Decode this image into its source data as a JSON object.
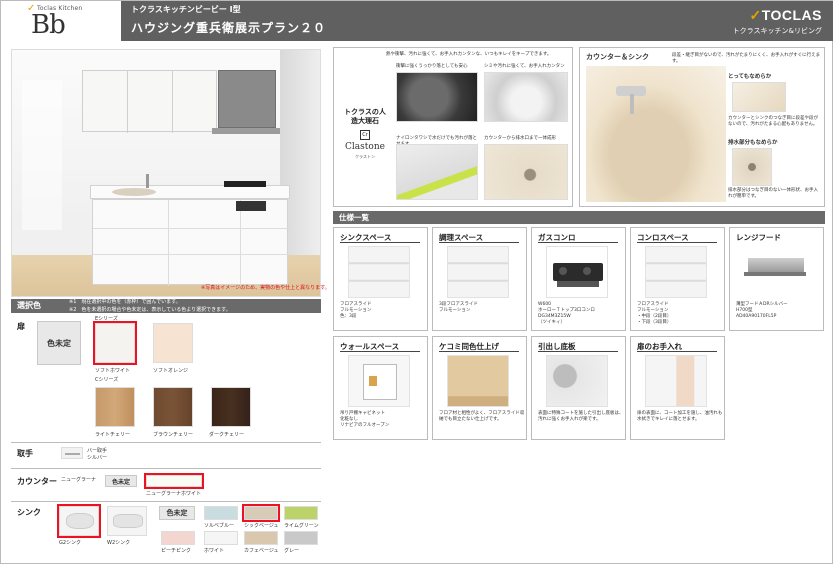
{
  "header": {
    "brand_small": "Toclas Kitchen",
    "brand_logo": "Bb",
    "subtitle": "トクラスキッチンビービー I型",
    "title": "ハウジング重兵衛展示プラン２０",
    "company": "TOCLAS",
    "company_sub": "トクラスキッチン&リビング"
  },
  "kitchen_note": "※写真はイメージのため、実物の色や仕上と異なります。",
  "selection": {
    "heading": "選択色",
    "note1": "※1　現在選択中の色を（赤枠）で囲んでいます。",
    "note2": "※2　色を未選択の場合や色未定は、表示している色より選択できます。"
  },
  "door": {
    "label": "扉",
    "undecided": "色未定",
    "series_e": "Eシリーズ",
    "series_c": "Cシリーズ",
    "swatches": [
      {
        "name": "ソフトホワイト",
        "color": "#f4f3ef"
      },
      {
        "name": "ソフトオレンジ",
        "color": "#f6e3d1"
      },
      {
        "name": "ライトチェリー",
        "color": "#c69a6a"
      },
      {
        "name": "ブラウンチェリー",
        "color": "#6f4a30"
      },
      {
        "name": "ダークチェリー",
        "color": "#3b2518"
      }
    ]
  },
  "handle": {
    "label": "取手",
    "name": "バー取手",
    "sub": "シルバー"
  },
  "counter": {
    "label": "カウンター",
    "name": "ニューグラーナ",
    "undecided": "色未定",
    "selected": "ニューグラーナホワイト"
  },
  "sink": {
    "label": "シンク",
    "undecided": "色未定",
    "types": [
      "G2シンク",
      "W2シンク"
    ],
    "colors": [
      {
        "name": "ソルベブルー",
        "color": "#c9dde0"
      },
      {
        "name": "シックベージュ",
        "color": "#d8cbb8"
      },
      {
        "name": "ライムグリーン",
        "color": "#bcd36a"
      },
      {
        "name": "ピーチピンク",
        "color": "#f3d6cf"
      },
      {
        "name": "ホワイト",
        "color": "#f5f5f5"
      },
      {
        "name": "カフェベージュ",
        "color": "#d9c8ad"
      },
      {
        "name": "グレー",
        "color": "#c9c9c9"
      }
    ]
  },
  "clastone": {
    "lead": "熱や衝撃、汚れに強くて、お手入れカンタンな、いつもキレイをキープできます。",
    "name_jp": "トクラスの人造大理石",
    "brand": "Clastone",
    "brand_sub": "クラストン",
    "captions": [
      "衝撃に強くうっかり落としても安心",
      "シミや汚れに強くて、お手入れカンタン",
      "ナイロンタワシで水だけでも汚れが落とせます",
      "カウンターから排水口まで一体成形"
    ]
  },
  "counter_sink": {
    "title": "カウンター＆シンク",
    "lead": "段差・継ぎ目がないので、汚れがたまりにくく、お手入れがすぐに行えます。",
    "smooth": "とってもなめらか",
    "smooth_desc": "カウンターとシンクのつなぎ目に段差や段がないので、汚れがたまる心配もありません。",
    "drain": "排水部分もなめらか",
    "drain_desc": "排水部分はつなぎ目のない一体形状、お手入れが簡単です。"
  },
  "spec": {
    "heading": "仕様一覧",
    "items": [
      {
        "title": "シンクスペース",
        "note": "フロアスライド\nフルモーション\n色：3段"
      },
      {
        "title": "調理スペース",
        "note": "3段フロアスライド\nフルモーション"
      },
      {
        "title": "ガスコンロ",
        "note": "W600\nホーローＴトップ3口コンロ\nDG34M3Z15W\n（ツイキィ）"
      },
      {
        "title": "コンロスペース",
        "note": "フロアスライド\nフルモーション\n・中段（2段目）\n・下段（3段目）"
      },
      {
        "title": "レンジフード",
        "note": "薄型フードＡDRシルバー\nH700型\nAD40A90170FL5P"
      },
      {
        "title": "ウォールスペース",
        "note": "吊り戸棚キャビネット\n化粧なし\nリナビアのフルオープン"
      },
      {
        "title": "ケコミ同色仕上げ",
        "note": "フロア材と相性がよく、フロアスライド収納でも目立たない仕上げです。"
      },
      {
        "title": "引出し底板",
        "note": "表面に特殊コートを施した引出し底板は、汚れに強くお手入れが楽です。"
      },
      {
        "title": "扉のお手入れ",
        "note": "扉の表面に、コート加工を施し、油汚れも水拭きでキレイに落とせます。"
      }
    ]
  }
}
